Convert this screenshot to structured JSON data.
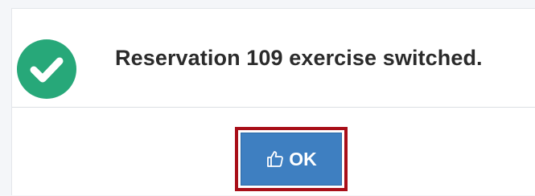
{
  "dialog": {
    "message": "Reservation 109 exercise switched.",
    "status_icon": "check-circle-icon",
    "ok_button": {
      "label": "OK",
      "icon": "thumbs-up-icon"
    }
  },
  "colors": {
    "success": "#27a879",
    "primary_button": "#3e7fc1",
    "focus_outline": "#a80e18"
  }
}
